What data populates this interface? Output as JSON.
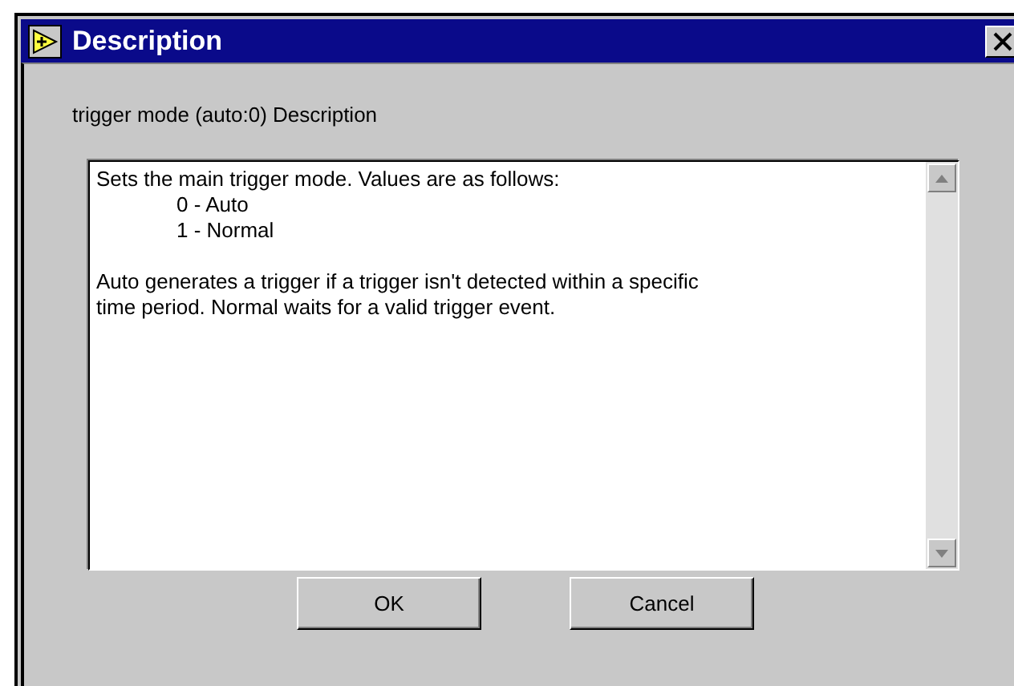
{
  "window": {
    "title": "Description"
  },
  "heading": "trigger mode (auto:0) Description",
  "description": {
    "paragraphs": [
      {
        "lines": [
          {
            "kind": "text",
            "text": "Sets the main trigger mode.  Values are as follows:"
          },
          {
            "kind": "item",
            "text": "0 - Auto"
          },
          {
            "kind": "item",
            "text": "1 - Normal"
          }
        ]
      },
      {
        "lines": [
          {
            "kind": "text",
            "text": "Auto generates a trigger if a trigger isn't detected within a specific"
          },
          {
            "kind": "text",
            "text": "time period.  Normal waits for a valid trigger event."
          }
        ]
      }
    ]
  },
  "buttons": [
    "OK",
    "Cancel"
  ]
}
